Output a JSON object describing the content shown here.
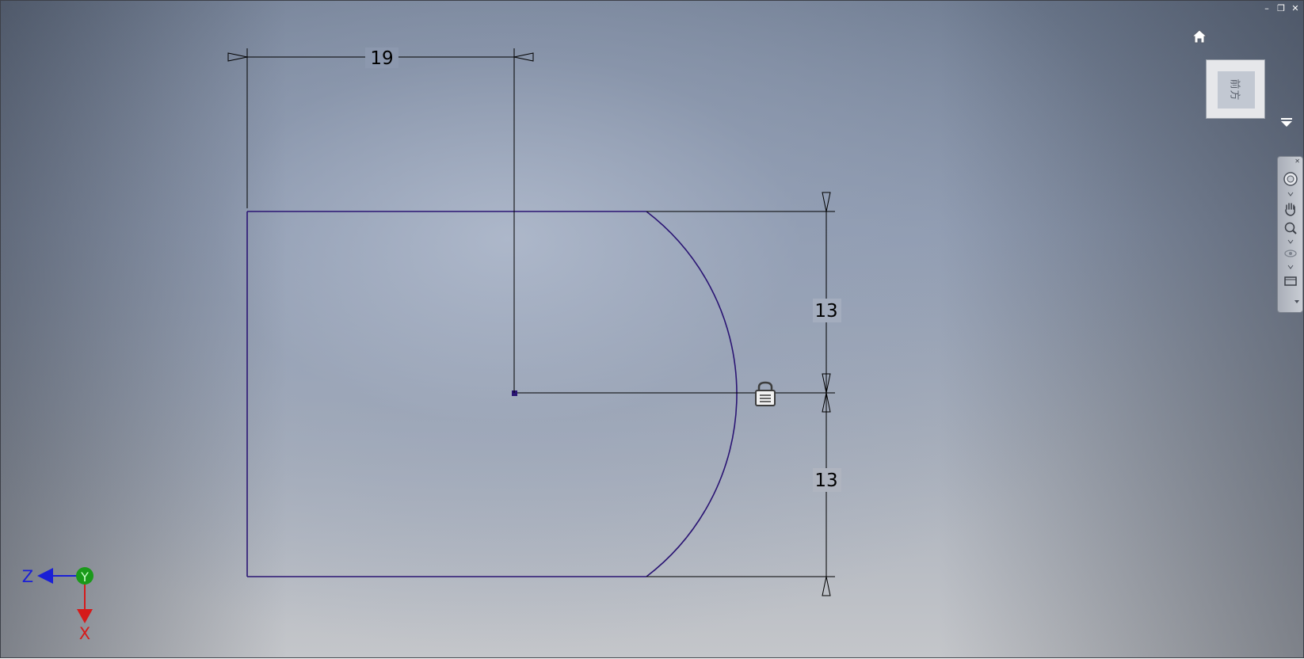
{
  "window": {
    "controls": {
      "minimize": "–",
      "restore": "❐",
      "close": "✕"
    }
  },
  "viewcube": {
    "face_label": "前方"
  },
  "dimensions": {
    "width_dimension": "19",
    "upper_height_dimension": "13",
    "lower_height_dimension": "13"
  },
  "triad": {
    "z_label": "Z",
    "y_label": "Y",
    "x_label": "X"
  },
  "colors": {
    "sketch_line": "#2a1473",
    "dimension_line": "#000000",
    "z_axis": "#1a1fd6",
    "y_axis": "#1a9a1a",
    "x_axis": "#d61a1a"
  },
  "icons": {
    "home": "home-icon",
    "viewcube_menu": "menu-triangle-icon",
    "lock": "lock-icon",
    "navbar": [
      "full-navigation-wheel-icon",
      "pan-hand-icon",
      "zoom-icon",
      "orbit-icon",
      "look-at-icon"
    ]
  }
}
